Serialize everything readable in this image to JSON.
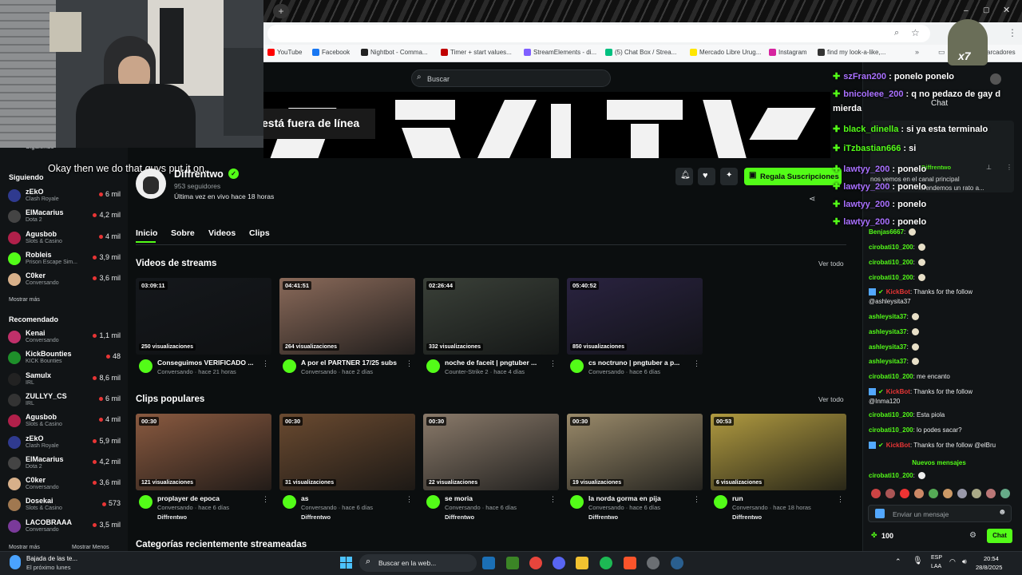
{
  "browser": {
    "bookmarks": [
      {
        "label": "YouTube",
        "color": "#ff0000"
      },
      {
        "label": "Facebook",
        "color": "#1877f2"
      },
      {
        "label": "Nightbot - Comma...",
        "color": "#222222"
      },
      {
        "label": "Timer + start values...",
        "color": "#c00000"
      },
      {
        "label": "StreamElements - di...",
        "color": "#7f5fff"
      },
      {
        "label": "(5) Chat Box / Strea...",
        "color": "#00c080"
      },
      {
        "label": "Mercado Libre Urug...",
        "color": "#ffe600"
      },
      {
        "label": "Instagram",
        "color": "#d6249f"
      },
      {
        "label": "find my look-a-like,...",
        "color": "#333333"
      }
    ],
    "bookmarks_folder": "arcadores"
  },
  "search": {
    "placeholder": "Buscar"
  },
  "banner": {
    "offline_text": "está fuera de línea"
  },
  "subtitle": "Okay then we do that guys put it on.",
  "sidebar": {
    "top_label": "Siguiendo",
    "following_heading": "Siguiendo",
    "following": [
      {
        "name": "zEkO",
        "cat": "Clash Royale",
        "count": "6 mil",
        "color": "#2f3a8f"
      },
      {
        "name": "ElMacarius",
        "cat": "Dota 2",
        "count": "4,2 mil",
        "color": "#444444"
      },
      {
        "name": "Agusbob",
        "cat": "Slots & Casino",
        "count": "4 mil",
        "color": "#b0204a"
      },
      {
        "name": "Robleis",
        "cat": "Prison Escape Sim...",
        "count": "3,9 mil",
        "color": "#53fc18"
      },
      {
        "name": "C0ker",
        "cat": "Conversando",
        "count": "3,6 mil",
        "color": "#d8b08a"
      }
    ],
    "show_more_1": "Mostrar más",
    "recommended_heading": "Recomendado",
    "recommended": [
      {
        "name": "Kenai",
        "cat": "Conversando",
        "count": "1,1 mil",
        "color": "#c0306a"
      },
      {
        "name": "KickBounties",
        "cat": "KICK Bounties",
        "count": "48",
        "color": "#1e8f2a"
      },
      {
        "name": "Samulx",
        "cat": "IRL",
        "count": "8,6 mil",
        "color": "#222222"
      },
      {
        "name": "ZULLYY_CS",
        "cat": "IRL",
        "count": "6 mil",
        "color": "#333333"
      },
      {
        "name": "Agusbob",
        "cat": "Slots & Casino",
        "count": "4 mil",
        "color": "#b0204a"
      },
      {
        "name": "zEkO",
        "cat": "Clash Royale",
        "count": "5,9 mil",
        "color": "#2f3a8f"
      },
      {
        "name": "ElMacarius",
        "cat": "Dota 2",
        "count": "4,2 mil",
        "color": "#444444"
      },
      {
        "name": "C0ker",
        "cat": "Conversando",
        "count": "3,6 mil",
        "color": "#d8b08a"
      },
      {
        "name": "Dosekai",
        "cat": "Slots & Casino",
        "count": "573",
        "color": "#a07850"
      },
      {
        "name": "LACOBRAAA",
        "cat": "Conversando",
        "count": "3,5 mil",
        "color": "#7a3a9a"
      }
    ],
    "show_more_2": "Mostrar más",
    "show_less": "Mostrar Menos"
  },
  "channel": {
    "name": "Diffrentwo",
    "followers": "953 seguidores",
    "last_live": "Última vez en vivo hace 18 horas",
    "subscribe_label": "Regala Suscripciones"
  },
  "tabs": [
    "Inicio",
    "Sobre",
    "Videos",
    "Clips"
  ],
  "streams": {
    "title": "Videos de streams",
    "see_all": "Ver todo",
    "items": [
      {
        "duration": "03:09:11",
        "views": "250 visualizaciones",
        "title": "Conseguimos VERIFICADO ...",
        "meta": "Conversando · hace 21 horas",
        "bg": "#15181c"
      },
      {
        "duration": "04:41:51",
        "views": "264 visualizaciones",
        "title": "A por el PARTNER 17/25 subs",
        "meta": "Conversando · hace 2 días",
        "bg": "#8a6a5a"
      },
      {
        "duration": "02:26:44",
        "views": "332 visualizaciones",
        "title": "noche de faceit | pngtuber ...",
        "meta": "Counter-Strike 2 · hace 4 días",
        "bg": "#3a4038"
      },
      {
        "duration": "05:40:52",
        "views": "850 visualizaciones",
        "title": "cs noctruno | pngtuber a p...",
        "meta": "Conversando · hace 6 días",
        "bg": "#2a2340"
      }
    ]
  },
  "clips": {
    "title": "Clips populares",
    "see_all": "Ver todo",
    "items": [
      {
        "duration": "00:30",
        "views": "121 visualizaciones",
        "title": "proplayer de epoca",
        "meta": "Conversando · hace 6 días",
        "author": "Diffrentwo",
        "bg": "#8a5a40"
      },
      {
        "duration": "00:30",
        "views": "31 visualizaciones",
        "title": "as",
        "meta": "Conversando · hace 6 días",
        "author": "Diffrentwo",
        "bg": "#6a4a30"
      },
      {
        "duration": "00:30",
        "views": "22 visualizaciones",
        "title": "se moria",
        "meta": "Conversando · hace 6 días",
        "author": "Diffrentwo",
        "bg": "#8a7a6a"
      },
      {
        "duration": "00:30",
        "views": "19 visualizaciones",
        "title": "la norda gorma en pija",
        "meta": "Conversando · hace 6 días",
        "author": "Diffrentwo",
        "bg": "#9a8a6a"
      },
      {
        "duration": "00:53",
        "views": "6 visualizaciones",
        "title": "run",
        "meta": "Conversando · hace 18 horas",
        "author": "Diffrentwo",
        "bg": "#b09a40"
      }
    ]
  },
  "categories_title": "Categorías recientemente streameadas",
  "overlay_chat": [
    {
      "user": "szFran200",
      "msg": "ponelo ponelo",
      "cls": "p"
    },
    {
      "user": "bnicoleee_200",
      "msg": "q no pedazo de gay d",
      "cls": "p"
    },
    {
      "user": "",
      "msg": "mierda",
      "cls": ""
    },
    {
      "user": "black_dinella",
      "msg": "si ya esta terminalo",
      "cls": "u"
    },
    {
      "user": "iTzbastian666",
      "msg": "si",
      "cls": "u"
    },
    {
      "user": "lawtyy_200",
      "msg": "ponelo",
      "cls": "p"
    },
    {
      "user": "lawtyy_200",
      "msg": "ponelo",
      "cls": "p"
    },
    {
      "user": "lawtyy_200",
      "msg": "ponelo",
      "cls": "p"
    },
    {
      "user": "lawtyy_200",
      "msg": "ponelo",
      "cls": "p"
    }
  ],
  "chat": {
    "title": "Chat",
    "pinned_user": "Diffrentwo",
    "pinned_text_1": "nos vemos en el canal principal",
    "pinned_text_2": "...rendemos un rato a...",
    "messages": [
      {
        "user": "Benjas6667",
        "msg": ""
      },
      {
        "user": "cirobati10_200",
        "msg": ""
      },
      {
        "user": "cirobati10_200",
        "msg": ""
      },
      {
        "user": "cirobati10_200",
        "msg": ""
      },
      {
        "user": "KickBot",
        "msg": "Thanks for the follow",
        "bot": true
      },
      {
        "user": "",
        "msg": "@ashleysita37"
      },
      {
        "user": "ashleysita37",
        "msg": ""
      },
      {
        "user": "ashleysita37",
        "msg": ""
      },
      {
        "user": "ashleysita37",
        "msg": ""
      },
      {
        "user": "ashleysita37",
        "msg": ""
      },
      {
        "user": "cirobati10_200",
        "msg": "me encanto"
      },
      {
        "user": "KickBot",
        "msg": "Thanks for the follow",
        "bot": true
      },
      {
        "user": "",
        "msg": "@Inma120"
      },
      {
        "user": "cirobati10_200",
        "msg": "Esta piola"
      },
      {
        "user": "cirobati10_200",
        "msg": "lo podes sacar?"
      },
      {
        "user": "KickBot",
        "msg": "Thanks for the follow @elBru",
        "bot": true
      }
    ],
    "new_messages": "Nuevos mensajes",
    "last_message": {
      "user": "cirobati10_200",
      "msg": ""
    },
    "input_placeholder": "Enviar un mensaje",
    "points": "100",
    "send_label": "Chat"
  },
  "taskbar": {
    "weather_title": "Bajada de las te...",
    "weather_sub": "El próximo lunes",
    "search_placeholder": "Buscar en la web...",
    "lang_1": "ESP",
    "lang_2": "LAA",
    "time": "20:54",
    "date": "28/8/2025"
  }
}
